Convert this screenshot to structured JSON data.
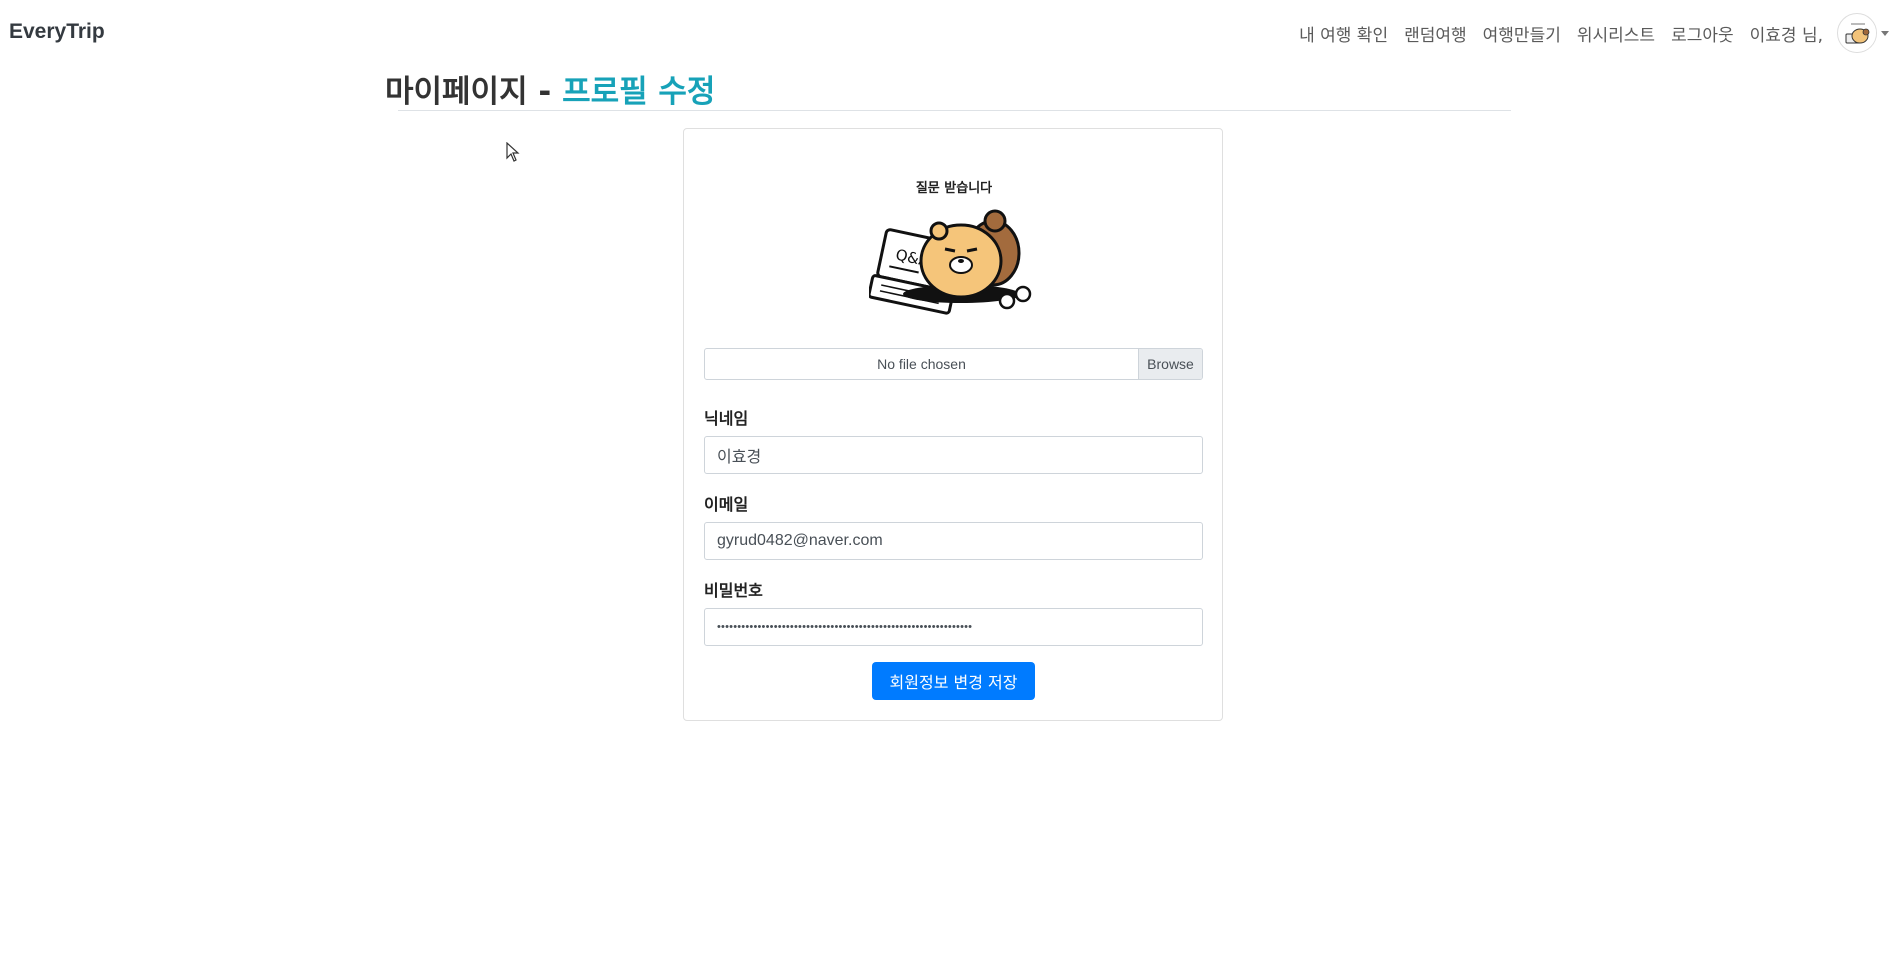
{
  "navbar": {
    "brand": "EveryTrip",
    "links": [
      "내 여행 확인",
      "랜덤여행",
      "여행만들기",
      "위시리스트",
      "로그아웃"
    ],
    "greeting": "이효경 님,"
  },
  "header": {
    "title_prefix": "마이페이지 - ",
    "title_accent": "프로필 수정"
  },
  "profile": {
    "image_caption": "질문 받습니다",
    "file_status": "No file chosen",
    "browse_label": "Browse"
  },
  "form": {
    "nickname_label": "닉네임",
    "nickname_value": "이효경",
    "email_label": "이메일",
    "email_value": "gyrud0482@naver.com",
    "password_label": "비밀번호",
    "password_value": "•••••••••••••••••••••••••••••••••••••••••••••••••••••••••••••••",
    "save_label": "회원정보 변경 저장"
  },
  "colors": {
    "accent": "#17a2b8",
    "primary_button": "#007bff"
  }
}
